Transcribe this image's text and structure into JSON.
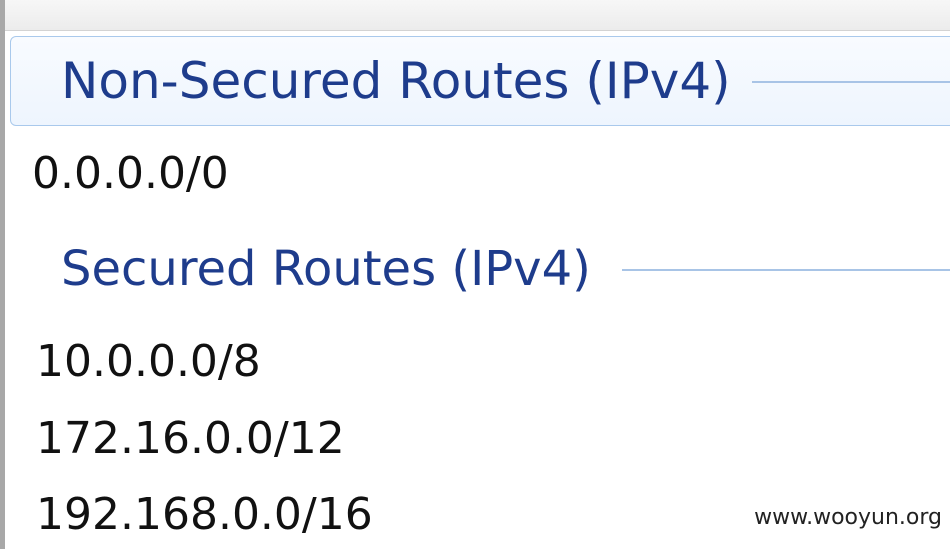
{
  "groups": {
    "non_secured": {
      "title": "Non-Secured Routes (IPv4)",
      "routes": [
        "0.0.0.0/0"
      ]
    },
    "secured": {
      "title": "Secured Routes (IPv4)",
      "routes": [
        "10.0.0.0/8",
        "172.16.0.0/12",
        "192.168.0.0/16"
      ]
    }
  },
  "watermark": "www.wooyun.org",
  "colors": {
    "group_title": "#1e3c8c",
    "selection_border": "#a9c9ec",
    "rule": "#a8c4e6"
  }
}
